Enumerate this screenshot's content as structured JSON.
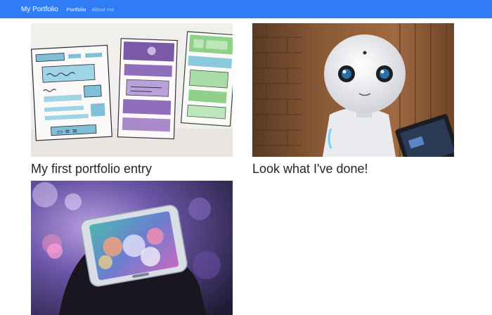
{
  "navbar": {
    "brand": "My Portfolio",
    "links": [
      "Portfolio",
      "About me"
    ],
    "background_color": "#2f7cf6"
  },
  "portfolio": {
    "entries": [
      {
        "title": "My first portfolio entry",
        "image": "wireframe-sketches-image"
      },
      {
        "title": "Look what I've done!",
        "image": "robot-image"
      },
      {
        "title": "",
        "image": "phone-bokeh-image"
      }
    ]
  }
}
